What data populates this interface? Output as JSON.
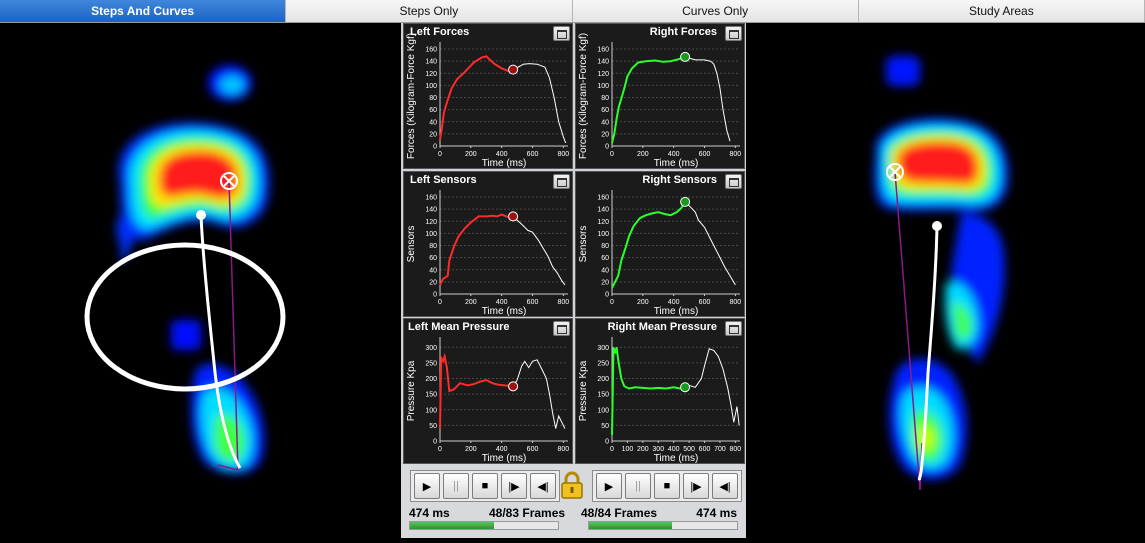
{
  "tabs": [
    "Steps And Curves",
    "Steps Only",
    "Curves Only",
    "Study Areas"
  ],
  "active_tab": 0,
  "colors": {
    "left": "#ff2a2a",
    "right": "#2aff2a",
    "trace": "#ffffff"
  },
  "charts": [
    {
      "title": "Left Forces",
      "ylabel": "Forces (Kilogram-Force Kgf)",
      "xlabel": "Time (ms)",
      "yticks": [
        "0",
        "20",
        "40",
        "60",
        "80",
        "100",
        "120",
        "140",
        "160"
      ],
      "ymax": 165,
      "xticks": [
        "0",
        "200",
        "400",
        "600",
        "800"
      ],
      "xmax": 830,
      "marker_color": "#ff2a2a",
      "colored": [
        [
          0,
          10
        ],
        [
          12,
          30
        ],
        [
          25,
          55
        ],
        [
          40,
          68
        ],
        [
          55,
          80
        ],
        [
          75,
          95
        ],
        [
          110,
          110
        ],
        [
          160,
          122
        ],
        [
          220,
          138
        ],
        [
          270,
          146
        ],
        [
          300,
          148
        ],
        [
          350,
          136
        ],
        [
          400,
          128
        ],
        [
          440,
          124
        ],
        [
          474,
          126
        ]
      ],
      "rest": [
        [
          474,
          126
        ],
        [
          520,
          132
        ],
        [
          540,
          135
        ],
        [
          580,
          136
        ],
        [
          630,
          135
        ],
        [
          680,
          130
        ],
        [
          710,
          112
        ],
        [
          740,
          80
        ],
        [
          770,
          40
        ],
        [
          800,
          15
        ],
        [
          815,
          5
        ]
      ]
    },
    {
      "title": "Right Forces",
      "ylabel": "Forces (Kilogram-Force Kgf)",
      "xlabel": "Time (ms)",
      "yticks": [
        "0",
        "20",
        "40",
        "60",
        "80",
        "100",
        "120",
        "140",
        "160"
      ],
      "ymax": 165,
      "xticks": [
        "0",
        "200",
        "400",
        "600",
        "800"
      ],
      "xmax": 830,
      "marker_color": "#2aff2a",
      "colored": [
        [
          0,
          5
        ],
        [
          15,
          20
        ],
        [
          30,
          45
        ],
        [
          45,
          65
        ],
        [
          60,
          78
        ],
        [
          80,
          95
        ],
        [
          100,
          115
        ],
        [
          130,
          128
        ],
        [
          170,
          138
        ],
        [
          220,
          140
        ],
        [
          280,
          141
        ],
        [
          330,
          139
        ],
        [
          380,
          140
        ],
        [
          430,
          143
        ],
        [
          474,
          147
        ]
      ],
      "rest": [
        [
          474,
          147
        ],
        [
          500,
          145
        ],
        [
          540,
          142
        ],
        [
          600,
          142
        ],
        [
          640,
          140
        ],
        [
          660,
          135
        ],
        [
          680,
          120
        ],
        [
          700,
          95
        ],
        [
          720,
          60
        ],
        [
          745,
          25
        ],
        [
          765,
          8
        ]
      ]
    },
    {
      "title": "Left Sensors",
      "ylabel": "Sensors",
      "xlabel": "Time (ms)",
      "yticks": [
        "0",
        "20",
        "40",
        "60",
        "80",
        "100",
        "120",
        "140",
        "160"
      ],
      "ymax": 165,
      "xticks": [
        "0",
        "200",
        "400",
        "600",
        "800"
      ],
      "xmax": 830,
      "marker_color": "#ff2a2a",
      "colored": [
        [
          0,
          15
        ],
        [
          20,
          25
        ],
        [
          50,
          30
        ],
        [
          60,
          55
        ],
        [
          90,
          78
        ],
        [
          120,
          95
        ],
        [
          160,
          108
        ],
        [
          200,
          118
        ],
        [
          250,
          128
        ],
        [
          300,
          128
        ],
        [
          340,
          129
        ],
        [
          370,
          128
        ],
        [
          400,
          131
        ],
        [
          440,
          127
        ],
        [
          474,
          128
        ]
      ],
      "rest": [
        [
          474,
          128
        ],
        [
          500,
          122
        ],
        [
          530,
          115
        ],
        [
          570,
          105
        ],
        [
          600,
          102
        ],
        [
          640,
          88
        ],
        [
          670,
          75
        ],
        [
          700,
          62
        ],
        [
          730,
          45
        ],
        [
          760,
          35
        ],
        [
          790,
          22
        ],
        [
          810,
          15
        ]
      ]
    },
    {
      "title": "Right Sensors",
      "ylabel": "Sensors",
      "xlabel": "Time (ms)",
      "yticks": [
        "0",
        "20",
        "40",
        "60",
        "80",
        "100",
        "120",
        "140",
        "160"
      ],
      "ymax": 165,
      "xticks": [
        "0",
        "200",
        "400",
        "600",
        "800"
      ],
      "xmax": 830,
      "marker_color": "#2aff2a",
      "colored": [
        [
          0,
          10
        ],
        [
          20,
          20
        ],
        [
          40,
          30
        ],
        [
          60,
          55
        ],
        [
          90,
          78
        ],
        [
          110,
          95
        ],
        [
          140,
          112
        ],
        [
          180,
          125
        ],
        [
          220,
          130
        ],
        [
          260,
          133
        ],
        [
          300,
          135
        ],
        [
          340,
          132
        ],
        [
          380,
          130
        ],
        [
          420,
          135
        ],
        [
          450,
          142
        ],
        [
          474,
          152
        ]
      ],
      "rest": [
        [
          474,
          152
        ],
        [
          490,
          148
        ],
        [
          510,
          143
        ],
        [
          540,
          135
        ],
        [
          560,
          122
        ],
        [
          600,
          110
        ],
        [
          640,
          90
        ],
        [
          670,
          75
        ],
        [
          700,
          60
        ],
        [
          730,
          45
        ],
        [
          770,
          28
        ],
        [
          800,
          15
        ]
      ]
    },
    {
      "title": "Left Mean Pressure",
      "ylabel": "Pressure Kpa",
      "xlabel": "Time (ms)",
      "yticks": [
        "0",
        "50",
        "100",
        "150",
        "200",
        "250",
        "300"
      ],
      "ymax": 320,
      "xticks": [
        "0",
        "200",
        "400",
        "600",
        "800"
      ],
      "xmax": 830,
      "marker_color": "#ff2a2a",
      "colored": [
        [
          0,
          40
        ],
        [
          8,
          265
        ],
        [
          20,
          255
        ],
        [
          30,
          270
        ],
        [
          45,
          235
        ],
        [
          60,
          160
        ],
        [
          90,
          165
        ],
        [
          130,
          185
        ],
        [
          180,
          178
        ],
        [
          220,
          182
        ],
        [
          260,
          190
        ],
        [
          300,
          195
        ],
        [
          340,
          185
        ],
        [
          380,
          180
        ],
        [
          420,
          178
        ],
        [
          474,
          175
        ]
      ],
      "rest": [
        [
          474,
          175
        ],
        [
          500,
          195
        ],
        [
          530,
          240
        ],
        [
          550,
          255
        ],
        [
          575,
          235
        ],
        [
          600,
          255
        ],
        [
          630,
          260
        ],
        [
          660,
          230
        ],
        [
          690,
          200
        ],
        [
          710,
          150
        ],
        [
          730,
          90
        ],
        [
          750,
          40
        ],
        [
          770,
          80
        ],
        [
          790,
          60
        ],
        [
          810,
          40
        ]
      ]
    },
    {
      "title": "Right Mean Pressure",
      "ylabel": "Pressure Kpa",
      "xlabel": "Time (ms)",
      "yticks": [
        "0",
        "50",
        "100",
        "150",
        "200",
        "250",
        "300"
      ],
      "ymax": 320,
      "xticks": [
        "0",
        "100",
        "200",
        "300",
        "400",
        "500",
        "600",
        "700",
        "800"
      ],
      "xmax": 830,
      "marker_color": "#2aff2a",
      "colored": [
        [
          0,
          20
        ],
        [
          10,
          300
        ],
        [
          20,
          280
        ],
        [
          30,
          300
        ],
        [
          40,
          260
        ],
        [
          60,
          200
        ],
        [
          80,
          175
        ],
        [
          110,
          168
        ],
        [
          150,
          172
        ],
        [
          200,
          170
        ],
        [
          250,
          168
        ],
        [
          300,
          170
        ],
        [
          350,
          168
        ],
        [
          400,
          172
        ],
        [
          440,
          168
        ],
        [
          474,
          172
        ]
      ],
      "rest": [
        [
          474,
          172
        ],
        [
          500,
          178
        ],
        [
          540,
          172
        ],
        [
          580,
          200
        ],
        [
          600,
          240
        ],
        [
          630,
          295
        ],
        [
          660,
          290
        ],
        [
          690,
          270
        ],
        [
          720,
          230
        ],
        [
          750,
          170
        ],
        [
          770,
          120
        ],
        [
          790,
          60
        ],
        [
          810,
          110
        ],
        [
          825,
          50
        ]
      ]
    }
  ],
  "controls": {
    "buttons": [
      "▶",
      "||",
      "■",
      "|▶",
      "◀|"
    ],
    "left": {
      "time": "474 ms",
      "frames": "48/83 Frames",
      "progress": 0.57
    },
    "right": {
      "time": "474 ms",
      "frames": "48/84 Frames",
      "progress": 0.56
    }
  }
}
